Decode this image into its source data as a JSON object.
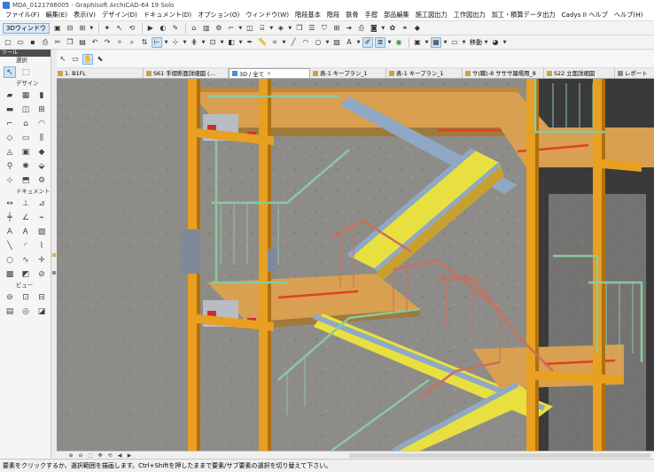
{
  "window": {
    "title": "MDA_0121786005 - Graphisoft ArchiCAD-64 19 Solo"
  },
  "menu": [
    "ファイル(F)",
    "編集(E)",
    "表示(V)",
    "デザイン(D)",
    "ドキュメント(D)",
    "オプション(O)",
    "ウィンドウ(W)",
    "階段基本",
    "階段",
    "鉄骨",
    "手摺",
    "部品編集",
    "施工図出力",
    "工作図出力",
    "加工・積算データ出力",
    "Cadys II ヘルプ",
    "ヘルプ(H)"
  ],
  "toolbar": {
    "view3d_label": "3Dウィンドウ",
    "move_label": "移動"
  },
  "toolbox": {
    "header": "ツール",
    "select_label": "選択",
    "section_design": "デザイン",
    "section_document": "ドキュメント",
    "section_view": "ビュー"
  },
  "tabs": [
    {
      "label": "1. B1FL"
    },
    {
      "label": "S61 手摺断面詳細図 (…"
    },
    {
      "label": "3D / 全て"
    },
    {
      "label": "表-1 キープラン_1"
    },
    {
      "label": "表-1 キープラン_1"
    },
    {
      "label": "サ(職)-8 サササ踊場用_8"
    },
    {
      "label": "S22 立面詳細図"
    },
    {
      "label": "レポート"
    }
  ],
  "active_tab": "3D / 全て",
  "status": {
    "message": "要素をクリックするか、選択範囲を描画します。Ctrl+Shiftを押したままで要素/サブ要素の選択を切り替えて下さい。"
  },
  "colors": {
    "concrete": "#8e8c88",
    "steel_orange": "#e8a020",
    "stringer_blue": "#8fa8c4",
    "tread_yellow": "#e8e040",
    "landing_wood": "#d8a050",
    "rail_green": "#8cc8a0",
    "rail_red": "#c8705c"
  }
}
